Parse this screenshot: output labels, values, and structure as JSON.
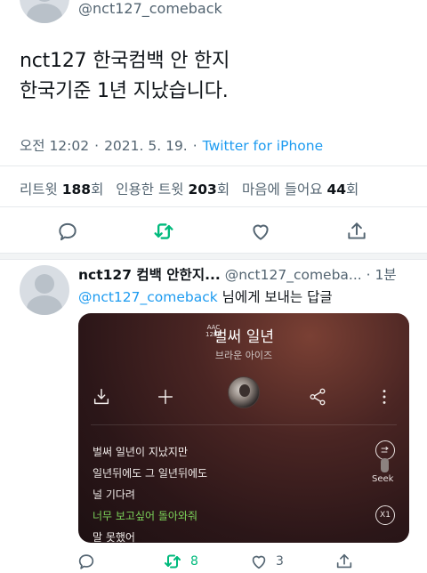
{
  "top_tweet": {
    "handle": "@nct127_comeback",
    "text_lines": [
      "nct127 한국컴백 안 한지",
      "한국기준 1년 지났습니다."
    ],
    "time": "오전 12:02",
    "date": "2021. 5. 19.",
    "source": "Twitter for iPhone",
    "stats": {
      "retweets_label": "리트윗",
      "retweets": "188",
      "retweets_unit": "회",
      "quotes_label": "인용한 트윗",
      "quotes": "203",
      "quotes_unit": "회",
      "likes_label": "마음에 들어요",
      "likes": "44",
      "likes_unit": "회"
    },
    "actions": [
      "reply-icon",
      "retweet-icon",
      "like-icon",
      "share-icon"
    ]
  },
  "reply_tweet": {
    "name": "nct127 컴백 안한지...",
    "handle": "@nct127_comeba...",
    "time": "1분",
    "reply_to_mention": "@nct127_comeback",
    "reply_to_suffix": "님에게 보내는 답글",
    "retweet_count": "8",
    "like_count": "3"
  },
  "music_card": {
    "codec_line1": "AAC",
    "codec_line2": "128K",
    "song_title": "벌써 일년",
    "artist": "브라운 아이즈",
    "lyrics": [
      "벌써 일년이 지났지만",
      "일년뒤에도 그 일년뒤에도",
      "널 기다려",
      "너무 보고싶어 돌아와줘",
      "말 못했어"
    ],
    "highlight_index": 3,
    "seek_label": "Seek",
    "speed_label": "X1",
    "colors": {
      "highlight": "#7cd35a"
    }
  },
  "colors": {
    "accent": "#1d9bf0",
    "retweet_green": "#00ba7c",
    "muted": "#536471"
  }
}
